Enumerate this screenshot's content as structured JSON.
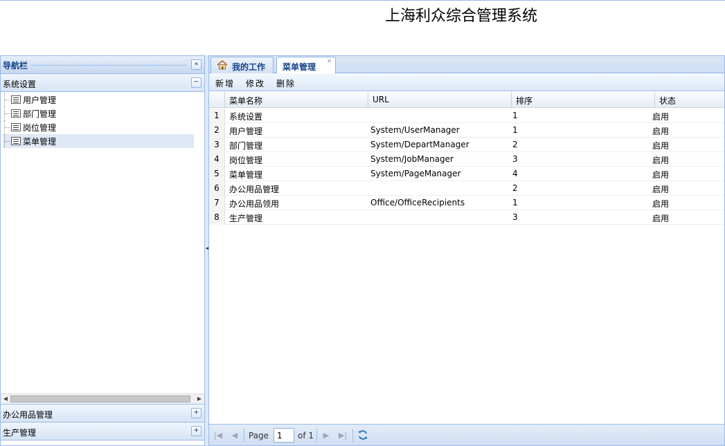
{
  "app": {
    "title": "上海利众综合管理系统"
  },
  "nav": {
    "title": "导航栏",
    "collapse_glyph": "«",
    "sections": [
      {
        "label": "系统设置",
        "expanded": true,
        "toggle": "−"
      },
      {
        "label": "办公用品管理",
        "expanded": false,
        "toggle": "+"
      },
      {
        "label": "生产管理",
        "expanded": false,
        "toggle": "+"
      }
    ],
    "tree": [
      {
        "label": "用户管理",
        "selected": false
      },
      {
        "label": "部门管理",
        "selected": false
      },
      {
        "label": "岗位管理",
        "selected": false
      },
      {
        "label": "菜单管理",
        "selected": true
      }
    ]
  },
  "tabs": [
    {
      "label": "我的工作",
      "icon": "home-icon",
      "active": false
    },
    {
      "label": "菜单管理",
      "active": true,
      "close": "×"
    }
  ],
  "toolbar": {
    "add": "新增",
    "edit": "修改",
    "delete": "删除"
  },
  "grid": {
    "columns": [
      "菜单名称",
      "URL",
      "排序",
      "状态"
    ],
    "rows": [
      {
        "n": "1",
        "name": "系统设置",
        "url": "",
        "order": "1",
        "status": "启用"
      },
      {
        "n": "2",
        "name": "用户管理",
        "url": "System/UserManager",
        "order": "1",
        "status": "启用"
      },
      {
        "n": "3",
        "name": "部门管理",
        "url": "System/DepartManager",
        "order": "2",
        "status": "启用"
      },
      {
        "n": "4",
        "name": "岗位管理",
        "url": "System/JobManager",
        "order": "3",
        "status": "启用"
      },
      {
        "n": "5",
        "name": "菜单管理",
        "url": "System/PageManager",
        "order": "4",
        "status": "启用"
      },
      {
        "n": "6",
        "name": "办公用品管理",
        "url": "",
        "order": "2",
        "status": "启用"
      },
      {
        "n": "7",
        "name": "办公用品领用",
        "url": "Office/OfficeRecipients",
        "order": "1",
        "status": "启用"
      },
      {
        "n": "8",
        "name": "生产管理",
        "url": "",
        "order": "3",
        "status": "启用"
      }
    ]
  },
  "pager": {
    "page_label": "Page",
    "current": "1",
    "of_label": "of 1"
  },
  "colors": {
    "border": "#99bbe8",
    "title": "#15428b",
    "selected": "#dfe8f6"
  }
}
